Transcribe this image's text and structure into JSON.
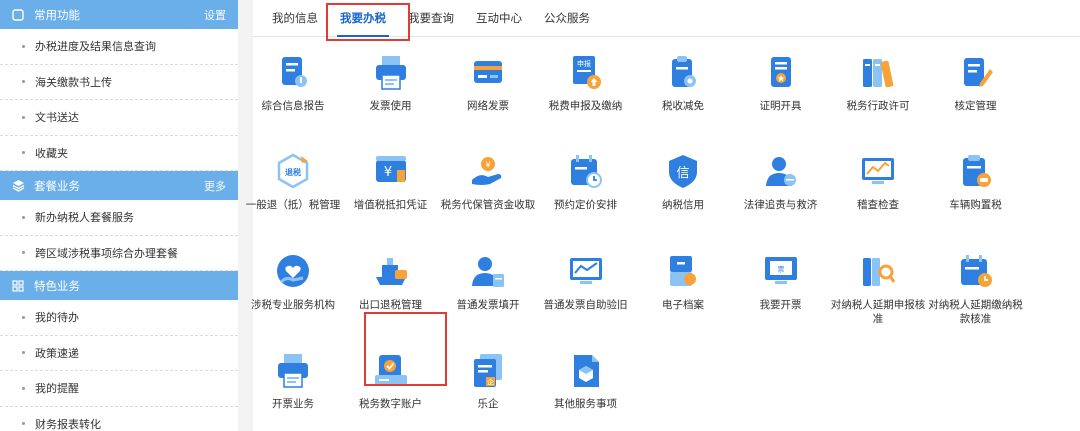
{
  "sidebar": {
    "sections": [
      {
        "title": "常用功能",
        "action": "设置",
        "icon": "square-outline-icon",
        "items": [
          "办税进度及结果信息查询",
          "海关缴款书上传",
          "文书送达",
          "收藏夹"
        ]
      },
      {
        "title": "套餐业务",
        "action": "更多",
        "icon": "layers-icon",
        "items": [
          "新办纳税人套餐服务",
          "跨区域涉税事项综合办理套餐"
        ]
      },
      {
        "title": "特色业务",
        "action": "",
        "icon": "grid-icon",
        "items": [
          "我的待办",
          "政策速递",
          "我的提醒",
          "财务报表转化"
        ]
      }
    ]
  },
  "tabs": [
    {
      "label": "我的信息",
      "active": false
    },
    {
      "label": "我要办税",
      "active": true
    },
    {
      "label": "我要查询",
      "active": false
    },
    {
      "label": "互动中心",
      "active": false
    },
    {
      "label": "公众服务",
      "active": false
    }
  ],
  "grid": [
    [
      {
        "label": "综合信息报告",
        "icon": "report-doc-icon"
      },
      {
        "label": "发票使用",
        "icon": "printer-icon"
      },
      {
        "label": "网络发票",
        "icon": "card-icon"
      },
      {
        "label": "税费申报及缴纳",
        "icon": "declare-upload-icon",
        "badge": "申报"
      },
      {
        "label": "税收减免",
        "icon": "clipboard-gear-icon"
      },
      {
        "label": "证明开具",
        "icon": "certificate-icon"
      },
      {
        "label": "税务行政许可",
        "icon": "binders-icon"
      },
      {
        "label": "核定管理",
        "icon": "edit-doc-icon"
      }
    ],
    [
      {
        "label": "一般退（抵）税管理",
        "icon": "refund-icon",
        "badge": "退税"
      },
      {
        "label": "增值税抵扣凭证",
        "icon": "voucher-yen-icon"
      },
      {
        "label": "税务代保管资金收取",
        "icon": "hand-coin-icon"
      },
      {
        "label": "预约定价安排",
        "icon": "calendar-clock-icon"
      },
      {
        "label": "纳税信用",
        "icon": "credit-icon",
        "badge": "信"
      },
      {
        "label": "法律追责与救济",
        "icon": "person-scale-icon"
      },
      {
        "label": "稽查检查",
        "icon": "monitor-chart-icon"
      },
      {
        "label": "车辆购置税",
        "icon": "clipboard-car-icon"
      }
    ],
    [
      {
        "label": "涉税专业服务机构",
        "icon": "hand-heart-icon"
      },
      {
        "label": "出口退税管理",
        "icon": "ship-export-icon"
      },
      {
        "label": "普通发票填开",
        "icon": "person-doc-icon"
      },
      {
        "label": "普通发票自助验旧",
        "icon": "monitor-line-icon"
      },
      {
        "label": "电子档案",
        "icon": "archive-icon"
      },
      {
        "label": "我要开票",
        "icon": "invoice-screen-icon"
      },
      {
        "label": "对纳税人延期申报核准",
        "icon": "binders-search-icon"
      },
      {
        "label": "对纳税人延期缴纳税款核准",
        "icon": "calendar-delay-icon"
      }
    ],
    [
      {
        "label": "开票业务",
        "icon": "printer-icon"
      },
      {
        "label": "税务数字账户",
        "icon": "digital-account-icon"
      },
      {
        "label": "乐企",
        "icon": "leqi-doc-icon",
        "badge": "企"
      },
      {
        "label": "其他服务事项",
        "icon": "cube-doc-icon"
      }
    ]
  ],
  "colors": {
    "sidebar_header": "#6aaeea",
    "active_tab": "#1a66c8",
    "highlight": "#e53935",
    "icon_blue": "#2f7fe0",
    "icon_light": "#8cc3f5",
    "icon_orange": "#f7a33a"
  }
}
